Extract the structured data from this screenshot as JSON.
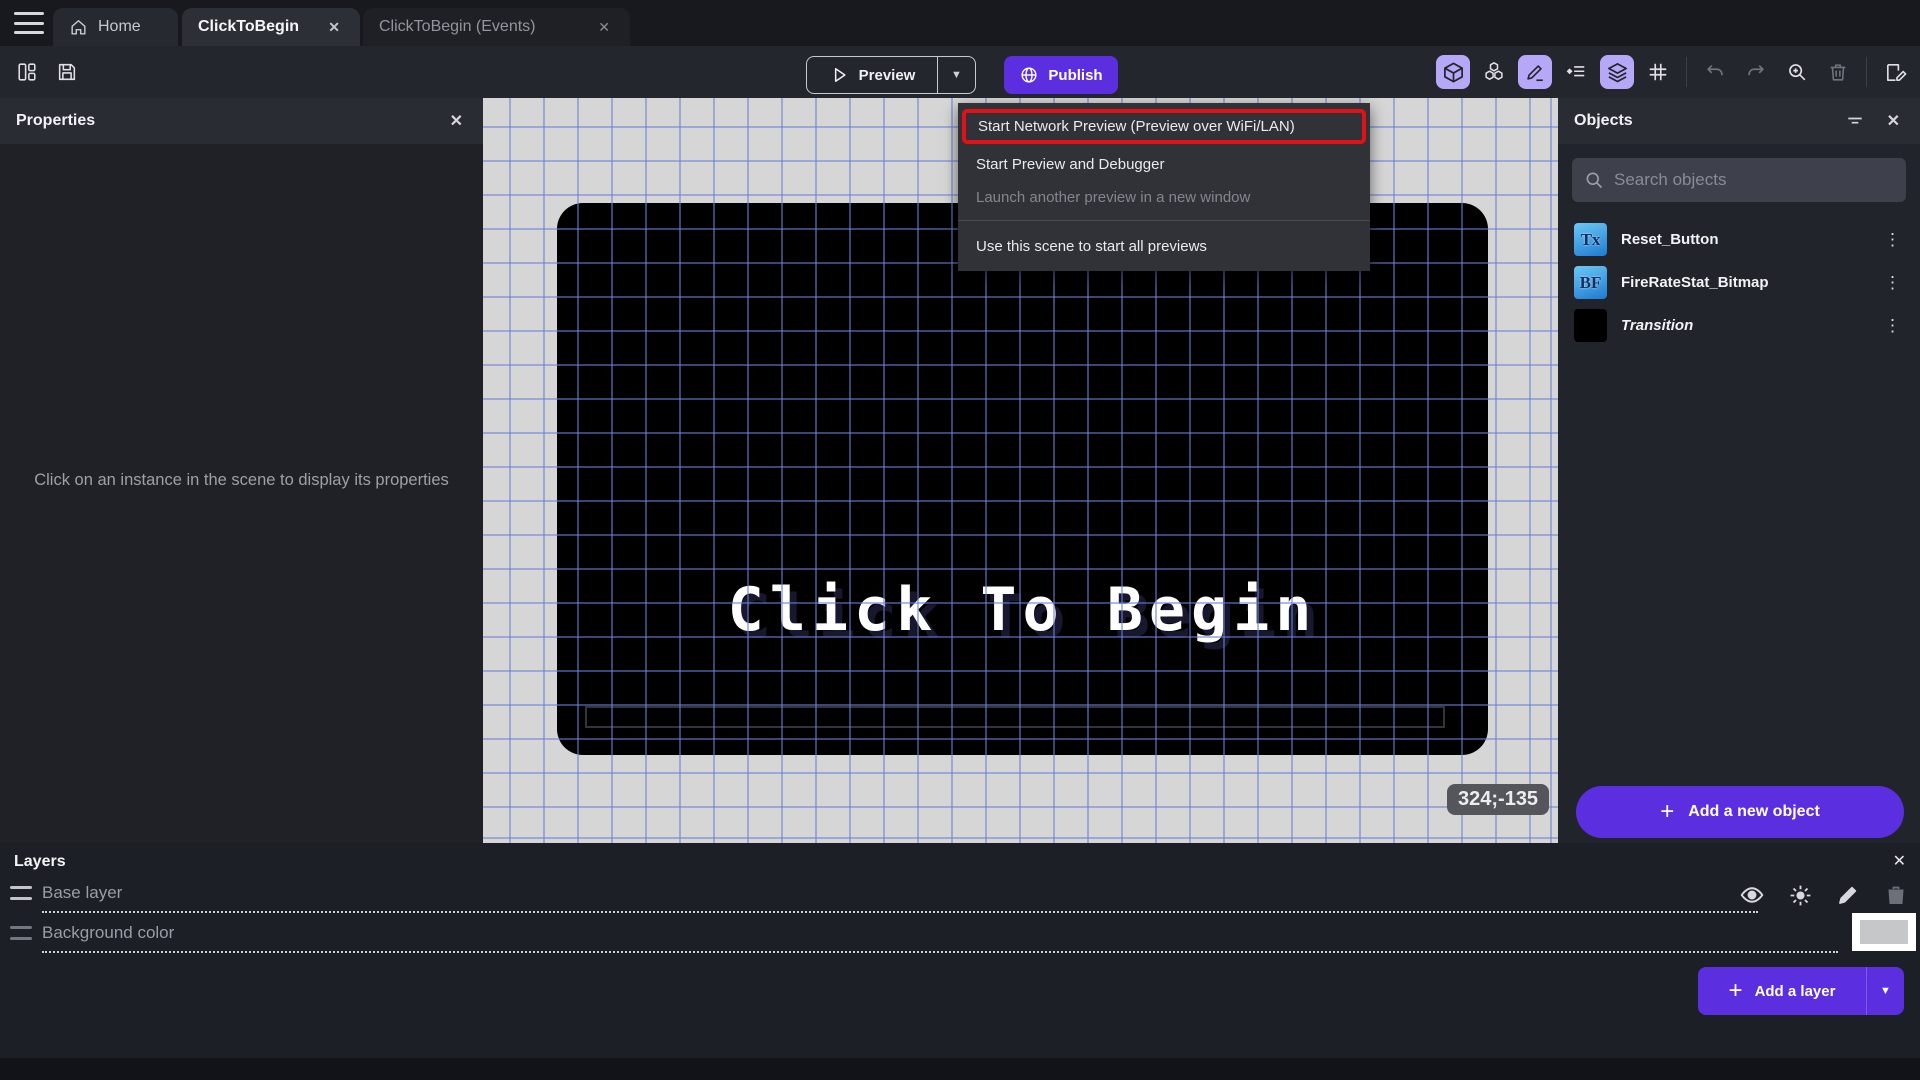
{
  "icons": {
    "close": "✕",
    "menu_dots": "⋮",
    "dropdown_arrow": "▼",
    "plus": "+"
  },
  "topbar": {
    "tabs": [
      {
        "label": "Home"
      },
      {
        "label": "ClickToBegin"
      },
      {
        "label": "ClickToBegin (Events)"
      }
    ]
  },
  "toolbar": {
    "preview_label": "Preview",
    "publish_label": "Publish"
  },
  "preview_menu": {
    "items": [
      {
        "label": "Start Network Preview (Preview over WiFi/LAN)"
      },
      {
        "label": "Start Preview and Debugger"
      },
      {
        "label": "Launch another preview in a new window"
      },
      {
        "label": "Use this scene to start all previews"
      }
    ]
  },
  "properties_panel": {
    "title": "Properties",
    "empty_message": "Click on an instance in the scene to display its properties"
  },
  "canvas": {
    "scene_text": "Click To Begin",
    "cursor_coordinates": "324;-135"
  },
  "objects_panel": {
    "title": "Objects",
    "search_placeholder": "Search objects",
    "objects": [
      {
        "name": "Reset_Button",
        "icon_text": "Tx"
      },
      {
        "name": "FireRateStat_Bitmap",
        "icon_text": "BF"
      },
      {
        "name": "Transition",
        "icon_text": ""
      }
    ],
    "add_button_label": "Add a new object"
  },
  "layers_panel": {
    "title": "Layers",
    "layers": [
      {
        "name": "Base layer"
      },
      {
        "name": "Background color"
      }
    ],
    "add_button_label": "Add a layer"
  },
  "colors": {
    "accent_purple": "#5b2ee0",
    "active_icon_background": "#b7a8f7",
    "annotation_highlight_red": "#e01218",
    "canvas_background": "#d6d6d6",
    "scene_background": "#000000"
  }
}
